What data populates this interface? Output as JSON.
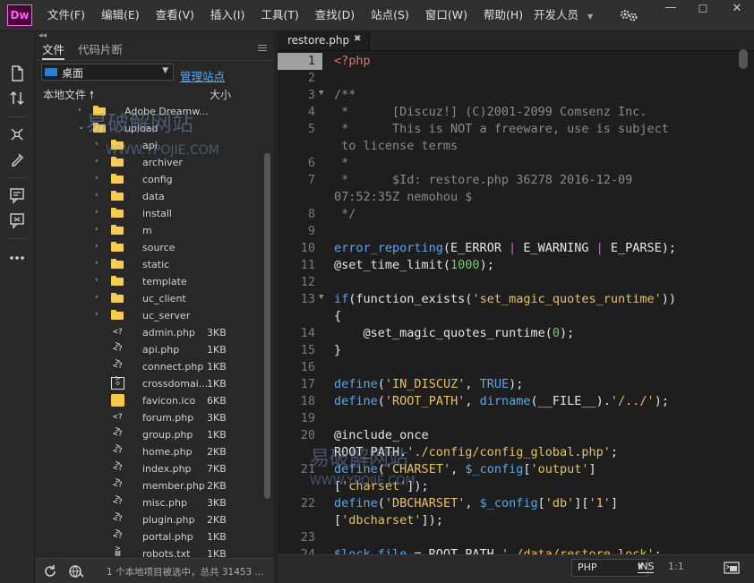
{
  "app": {
    "logo": "Dw",
    "menus": [
      "文件(F)",
      "编辑(E)",
      "查看(V)",
      "插入(I)",
      "工具(T)",
      "查找(D)",
      "站点(S)",
      "窗口(W)",
      "帮助(H)"
    ],
    "workspace": "开发人员"
  },
  "files_panel": {
    "tabs": [
      "文件",
      "代码片断"
    ],
    "site": "桌面",
    "manage_sites": "管理站点",
    "col_name": "本地文件",
    "col_size": "大小",
    "rows": [
      {
        "name": "Adobe Dreamw...",
        "type": "folder",
        "level": 1,
        "expanded": false,
        "size": ""
      },
      {
        "name": "upload",
        "type": "folder",
        "level": 1,
        "expanded": true,
        "size": ""
      },
      {
        "name": "api",
        "type": "folder",
        "level": 2,
        "expanded": false,
        "size": ""
      },
      {
        "name": "archiver",
        "type": "folder",
        "level": 2,
        "expanded": false,
        "size": ""
      },
      {
        "name": "config",
        "type": "folder",
        "level": 2,
        "expanded": false,
        "size": ""
      },
      {
        "name": "data",
        "type": "folder",
        "level": 2,
        "expanded": false,
        "size": ""
      },
      {
        "name": "install",
        "type": "folder",
        "level": 2,
        "expanded": false,
        "size": ""
      },
      {
        "name": "m",
        "type": "folder",
        "level": 2,
        "expanded": false,
        "size": ""
      },
      {
        "name": "source",
        "type": "folder",
        "level": 2,
        "expanded": false,
        "size": ""
      },
      {
        "name": "static",
        "type": "folder",
        "level": 2,
        "expanded": false,
        "size": ""
      },
      {
        "name": "template",
        "type": "folder",
        "level": 2,
        "expanded": false,
        "size": ""
      },
      {
        "name": "uc_client",
        "type": "folder",
        "level": 2,
        "expanded": false,
        "size": ""
      },
      {
        "name": "uc_server",
        "type": "folder",
        "level": 2,
        "expanded": false,
        "size": ""
      },
      {
        "name": "admin.php",
        "type": "php",
        "level": 2,
        "size": "3KB"
      },
      {
        "name": "api.php",
        "type": "php",
        "level": 2,
        "size": "1KB"
      },
      {
        "name": "connect.php",
        "type": "php",
        "level": 2,
        "size": "1KB"
      },
      {
        "name": "crossdomai...",
        "type": "xml",
        "level": 2,
        "size": "1KB"
      },
      {
        "name": "favicon.ico",
        "type": "ico",
        "level": 2,
        "size": "6KB"
      },
      {
        "name": "forum.php",
        "type": "php",
        "level": 2,
        "size": "3KB"
      },
      {
        "name": "group.php",
        "type": "php",
        "level": 2,
        "size": "1KB"
      },
      {
        "name": "home.php",
        "type": "php",
        "level": 2,
        "size": "2KB"
      },
      {
        "name": "index.php",
        "type": "php",
        "level": 2,
        "size": "7KB"
      },
      {
        "name": "member.php",
        "type": "php",
        "level": 2,
        "size": "2KB"
      },
      {
        "name": "misc.php",
        "type": "php",
        "level": 2,
        "size": "3KB"
      },
      {
        "name": "plugin.php",
        "type": "php",
        "level": 2,
        "size": "2KB"
      },
      {
        "name": "portal.php",
        "type": "php",
        "level": 2,
        "size": "1KB"
      },
      {
        "name": "robots.txt",
        "type": "txt",
        "level": 2,
        "size": "1KB"
      }
    ],
    "status": "1 个本地项目被选中，总共 31453 ..."
  },
  "editor": {
    "tab_label": "restore.php",
    "current_line": 1,
    "lines": [
      {
        "num": "1",
        "fold": false,
        "parts": [
          {
            "c": "tag",
            "t": "<?php"
          }
        ]
      },
      {
        "num": "2",
        "fold": false,
        "parts": []
      },
      {
        "num": "3",
        "fold": true,
        "parts": [
          {
            "c": "c",
            "t": "/**"
          }
        ]
      },
      {
        "num": "4",
        "fold": false,
        "parts": [
          {
            "c": "c",
            "t": " *      [Discuz!] (C)2001-2099 Comsenz Inc."
          }
        ]
      },
      {
        "num": "5",
        "fold": false,
        "parts": [
          {
            "c": "c",
            "t": " *      This is NOT a freeware, use is subject"
          }
        ]
      },
      {
        "num": "",
        "fold": false,
        "parts": [
          {
            "c": "c",
            "t": " to license terms"
          }
        ]
      },
      {
        "num": "6",
        "fold": false,
        "parts": [
          {
            "c": "c",
            "t": " *"
          }
        ]
      },
      {
        "num": "7",
        "fold": false,
        "parts": [
          {
            "c": "c",
            "t": " *      $Id: restore.php 36278 2016-12-09"
          }
        ]
      },
      {
        "num": "",
        "fold": false,
        "parts": [
          {
            "c": "c",
            "t": "07:52:35Z nemohou $"
          }
        ]
      },
      {
        "num": "8",
        "fold": false,
        "parts": [
          {
            "c": "c",
            "t": " */"
          }
        ]
      },
      {
        "num": "9",
        "fold": false,
        "parts": []
      },
      {
        "num": "10",
        "fold": false,
        "parts": [
          {
            "c": "k",
            "t": "error_reporting"
          },
          {
            "c": "",
            "t": "(E_ERROR "
          },
          {
            "c": "op",
            "t": "|"
          },
          {
            "c": "",
            "t": " E_WARNING "
          },
          {
            "c": "op",
            "t": "|"
          },
          {
            "c": "",
            "t": " E_PARSE);"
          }
        ]
      },
      {
        "num": "11",
        "fold": false,
        "parts": [
          {
            "c": "",
            "t": "@set_time_limit("
          },
          {
            "c": "n",
            "t": "1000"
          },
          {
            "c": "",
            "t": ");"
          }
        ]
      },
      {
        "num": "12",
        "fold": false,
        "parts": []
      },
      {
        "num": "13",
        "fold": true,
        "parts": [
          {
            "c": "k",
            "t": "if"
          },
          {
            "c": "",
            "t": "(function_exists("
          },
          {
            "c": "s",
            "t": "'set_magic_quotes_runtime'"
          },
          {
            "c": "",
            "t": "))"
          }
        ]
      },
      {
        "num": "",
        "fold": false,
        "parts": [
          {
            "c": "",
            "t": "{"
          }
        ]
      },
      {
        "num": "14",
        "fold": false,
        "parts": [
          {
            "c": "",
            "t": "    @set_magic_quotes_runtime("
          },
          {
            "c": "n",
            "t": "0"
          },
          {
            "c": "",
            "t": ");"
          }
        ]
      },
      {
        "num": "15",
        "fold": false,
        "parts": [
          {
            "c": "",
            "t": "}"
          }
        ]
      },
      {
        "num": "16",
        "fold": false,
        "parts": []
      },
      {
        "num": "17",
        "fold": false,
        "parts": [
          {
            "c": "k",
            "t": "define"
          },
          {
            "c": "",
            "t": "("
          },
          {
            "c": "s",
            "t": "'IN_DISCUZ'"
          },
          {
            "c": "",
            "t": ", "
          },
          {
            "c": "k",
            "t": "TRUE"
          },
          {
            "c": "",
            "t": ");"
          }
        ]
      },
      {
        "num": "18",
        "fold": false,
        "parts": [
          {
            "c": "k",
            "t": "define"
          },
          {
            "c": "",
            "t": "("
          },
          {
            "c": "s",
            "t": "'ROOT_PATH'"
          },
          {
            "c": "",
            "t": ", "
          },
          {
            "c": "k",
            "t": "dirname"
          },
          {
            "c": "",
            "t": "(__FILE__)."
          },
          {
            "c": "s",
            "t": "'/../'"
          },
          {
            "c": "",
            "t": ");"
          }
        ]
      },
      {
        "num": "19",
        "fold": false,
        "parts": []
      },
      {
        "num": "20",
        "fold": false,
        "parts": [
          {
            "c": "",
            "t": "@include_once"
          }
        ]
      },
      {
        "num": "",
        "fold": false,
        "parts": [
          {
            "c": "",
            "t": "ROOT_PATH."
          },
          {
            "c": "s",
            "t": "'./config/config_global.php'"
          },
          {
            "c": "",
            "t": ";"
          }
        ]
      },
      {
        "num": "21",
        "fold": false,
        "parts": [
          {
            "c": "k",
            "t": "define"
          },
          {
            "c": "",
            "t": "("
          },
          {
            "c": "s",
            "t": "'CHARSET'"
          },
          {
            "c": "",
            "t": ", "
          },
          {
            "c": "k",
            "t": "$_config"
          },
          {
            "c": "",
            "t": "["
          },
          {
            "c": "s",
            "t": "'output'"
          },
          {
            "c": "",
            "t": "]"
          }
        ]
      },
      {
        "num": "",
        "fold": false,
        "parts": [
          {
            "c": "",
            "t": "["
          },
          {
            "c": "s",
            "t": "'charset'"
          },
          {
            "c": "",
            "t": "]);"
          }
        ]
      },
      {
        "num": "22",
        "fold": false,
        "parts": [
          {
            "c": "k",
            "t": "define"
          },
          {
            "c": "",
            "t": "("
          },
          {
            "c": "s",
            "t": "'DBCHARSET'"
          },
          {
            "c": "",
            "t": ", "
          },
          {
            "c": "k",
            "t": "$_config"
          },
          {
            "c": "",
            "t": "["
          },
          {
            "c": "s",
            "t": "'db'"
          },
          {
            "c": "",
            "t": "]["
          },
          {
            "c": "s",
            "t": "'1'"
          },
          {
            "c": "",
            "t": "]"
          }
        ]
      },
      {
        "num": "",
        "fold": false,
        "parts": [
          {
            "c": "",
            "t": "["
          },
          {
            "c": "s",
            "t": "'dbcharset'"
          },
          {
            "c": "",
            "t": "]);"
          }
        ]
      },
      {
        "num": "23",
        "fold": false,
        "parts": []
      },
      {
        "num": "24",
        "fold": false,
        "parts": [
          {
            "c": "k",
            "t": "$lock_file"
          },
          {
            "c": "",
            "t": " = ROOT_PATH."
          },
          {
            "c": "s",
            "t": "'./data/restore.lock'"
          },
          {
            "c": "",
            "t": ";"
          }
        ]
      }
    ],
    "status": {
      "language": "PHP",
      "mode": "INS",
      "position": "1:1"
    }
  },
  "watermarks": [
    "易破解网站",
    "WWW.YPOJIE.COM"
  ],
  "colors": {
    "keyword": "#5aa7f0",
    "string": "#e8c06a",
    "number": "#6ecf6e",
    "comment": "#8a8a8a",
    "php_tag": "#ef6b6b",
    "operator": "#c76bd1",
    "link": "#5aa7f0",
    "logo": "#ff61f6"
  }
}
